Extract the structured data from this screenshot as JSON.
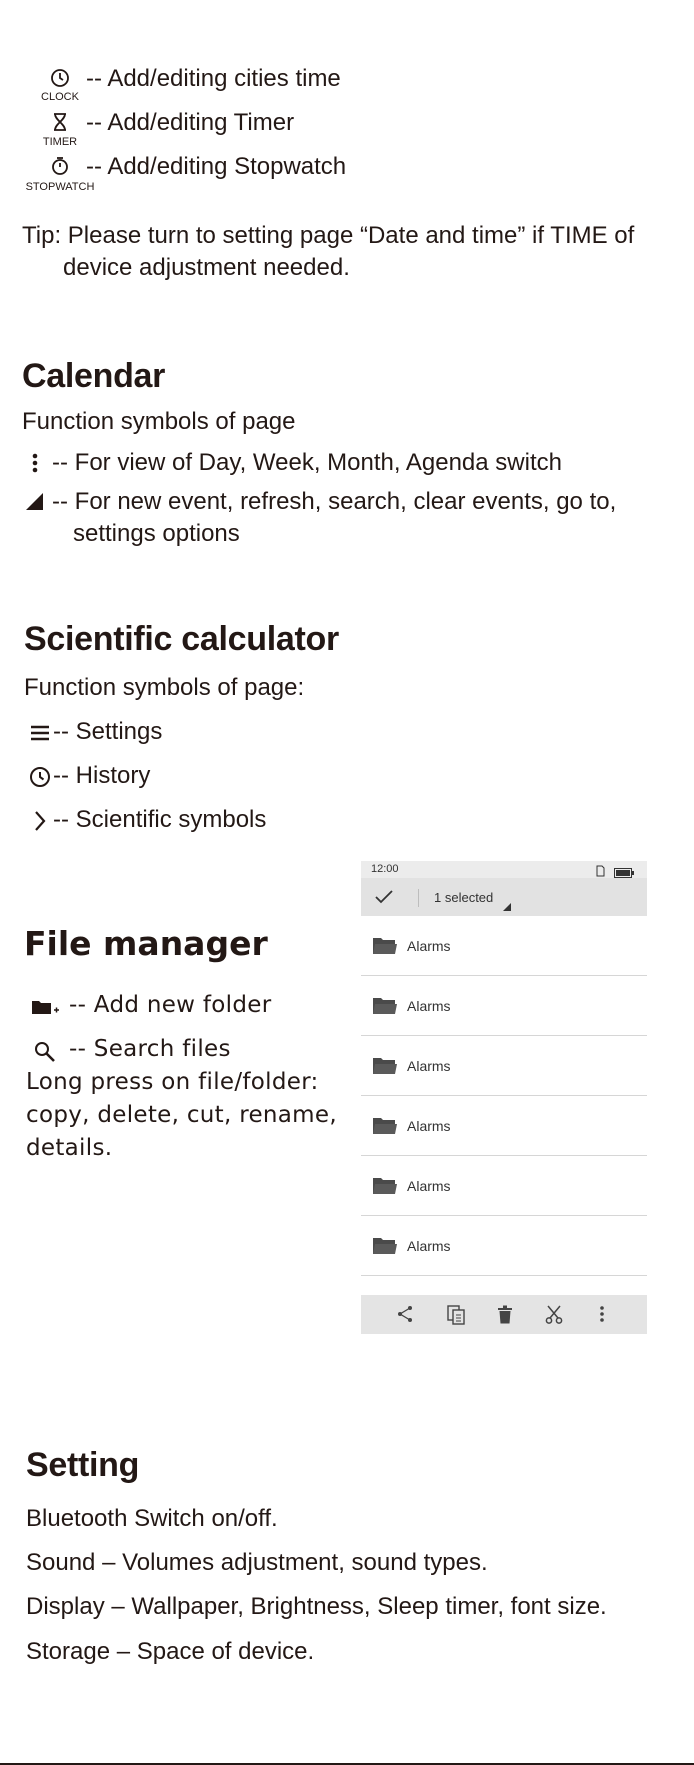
{
  "clock_section": {
    "items": [
      {
        "icon": "clock-icon",
        "caption": "CLOCK",
        "text": "-- Add/editing cities time"
      },
      {
        "icon": "hourglass-icon",
        "caption": "TIMER",
        "text": "-- Add/editing Timer"
      },
      {
        "icon": "stopwatch-icon",
        "caption": "STOPWATCH",
        "text": "-- Add/editing Stopwatch"
      }
    ],
    "tip_line1": "Tip: Please turn to setting page “Date and time”  if  TIME of",
    "tip_line2": "device adjustment needed."
  },
  "calendar": {
    "title": "Calendar",
    "subtitle": "Function symbols of page",
    "items": [
      {
        "icon": "vertical-dots-icon",
        "line1": "-- For view of Day, Week, Month, Agenda switch"
      },
      {
        "icon": "corner-triangle-icon",
        "line1": "-- For new event, refresh, search, clear events, go to,",
        "line2": "settings options"
      }
    ]
  },
  "calculator": {
    "title": "Scientific calculator",
    "subtitle": "Function symbols of page:",
    "items": [
      {
        "icon": "menu-lines-icon",
        "text": "-- Settings"
      },
      {
        "icon": "history-clock-icon",
        "text": "-- History"
      },
      {
        "icon": "chevron-right-icon",
        "text": "-- Scientific symbols"
      }
    ]
  },
  "file_manager": {
    "title": "File manager",
    "items": [
      {
        "icon": "add-folder-icon",
        "text": "-- Add new folder"
      },
      {
        "icon": "search-icon",
        "text": "-- Search files"
      }
    ],
    "long_press": [
      "Long press on file/folder:",
      "copy, delete, cut, rename,",
      "details."
    ],
    "phone": {
      "status_time": "12:00",
      "selected_label": "1 selected",
      "files": [
        "Alarms",
        "Alarms",
        "Alarms",
        "Alarms",
        "Alarms",
        "Alarms"
      ],
      "toolbar_icons": [
        "share-icon",
        "copy-icon",
        "delete-icon",
        "cut-icon",
        "more-icon"
      ]
    }
  },
  "setting": {
    "title": "Setting",
    "lines": [
      "Bluetooth Switch on/off.",
      "Sound – Volumes adjustment, sound types.",
      "Display – Wallpaper, Brightness, Sleep timer, font size.",
      "Storage – Space of device."
    ]
  },
  "colors": {
    "text": "#231815",
    "bar": "#e2e2e2",
    "folder": "#4a4a4a"
  }
}
